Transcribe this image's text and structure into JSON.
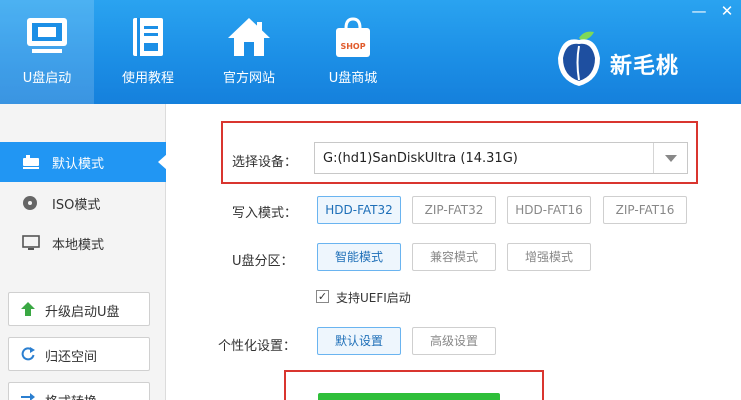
{
  "nav": {
    "items": [
      {
        "label": "U盘启动",
        "icon": "usb-boot-icon"
      },
      {
        "label": "使用教程",
        "icon": "tutorial-book-icon"
      },
      {
        "label": "官方网站",
        "icon": "home-icon"
      },
      {
        "label": "U盘商城",
        "icon": "shop-bag-icon"
      }
    ],
    "shop_icon_text": "SHOP"
  },
  "brand": {
    "name": "新毛桃"
  },
  "sidebar": {
    "modes": [
      {
        "label": "默认模式",
        "icon": "usb-drive-icon"
      },
      {
        "label": "ISO模式",
        "icon": "disc-icon"
      },
      {
        "label": "本地模式",
        "icon": "monitor-icon"
      }
    ],
    "tools": [
      {
        "label": "升级启动U盘",
        "icon": "upgrade-arrow-icon"
      },
      {
        "label": "归还空间",
        "icon": "restore-icon"
      },
      {
        "label": "格式转换",
        "icon": "convert-icon"
      }
    ]
  },
  "form": {
    "device_label": "选择设备：",
    "device_value": "G:(hd1)SanDiskUltra (14.31G)",
    "write_mode_label": "写入模式：",
    "write_modes": [
      "HDD-FAT32",
      "ZIP-FAT32",
      "HDD-FAT16",
      "ZIP-FAT16"
    ],
    "partition_label": "U盘分区：",
    "partition_modes": [
      "智能模式",
      "兼容模式",
      "增强模式"
    ],
    "uefi_label": "支持UEFI启动",
    "uefi_checked": "✓",
    "personal_label": "个性化设置：",
    "personal_modes": [
      "默认设置",
      "高级设置"
    ]
  },
  "colors": {
    "header_blue": "#1c8fe6",
    "active_blue": "#2196f3",
    "highlight_red": "#d9352f",
    "start_green": "#2fbf3a"
  }
}
